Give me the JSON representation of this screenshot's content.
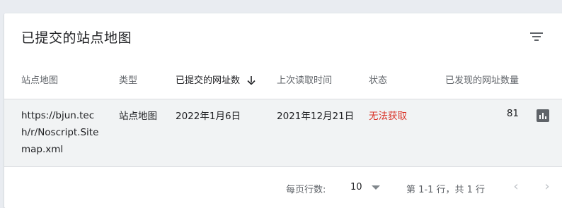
{
  "card": {
    "title": "已提交的站点地图",
    "filter_icon": "filter-list-icon"
  },
  "table": {
    "columns": [
      {
        "label": "站点地图"
      },
      {
        "label": "类型"
      },
      {
        "label": "已提交的网址数",
        "sorted": "descending"
      },
      {
        "label": "上次读取时间"
      },
      {
        "label": "状态"
      },
      {
        "label": "已发现的网址数量"
      }
    ],
    "rows": [
      {
        "sitemap": "https://bjun.tech/r/Noscript.Sitemap.xml",
        "type": "站点地图",
        "submitted": "2022年1月6日",
        "last_read": "2021年12月21日",
        "status": "无法获取",
        "discovered": "81",
        "action_icon": "bar-chart-icon"
      }
    ]
  },
  "pagination": {
    "rows_per_page_label": "每页行数:",
    "rows_per_page_value": "10",
    "range_text": "第 1-1 行，共 1 行",
    "prev_icon": "chevron-left-icon",
    "next_icon": "chevron-right-icon"
  },
  "colors": {
    "page_bg": "#e9ecf1",
    "row_bg": "#f1f3f4",
    "error": "#d93025",
    "muted": "#5f6368"
  }
}
